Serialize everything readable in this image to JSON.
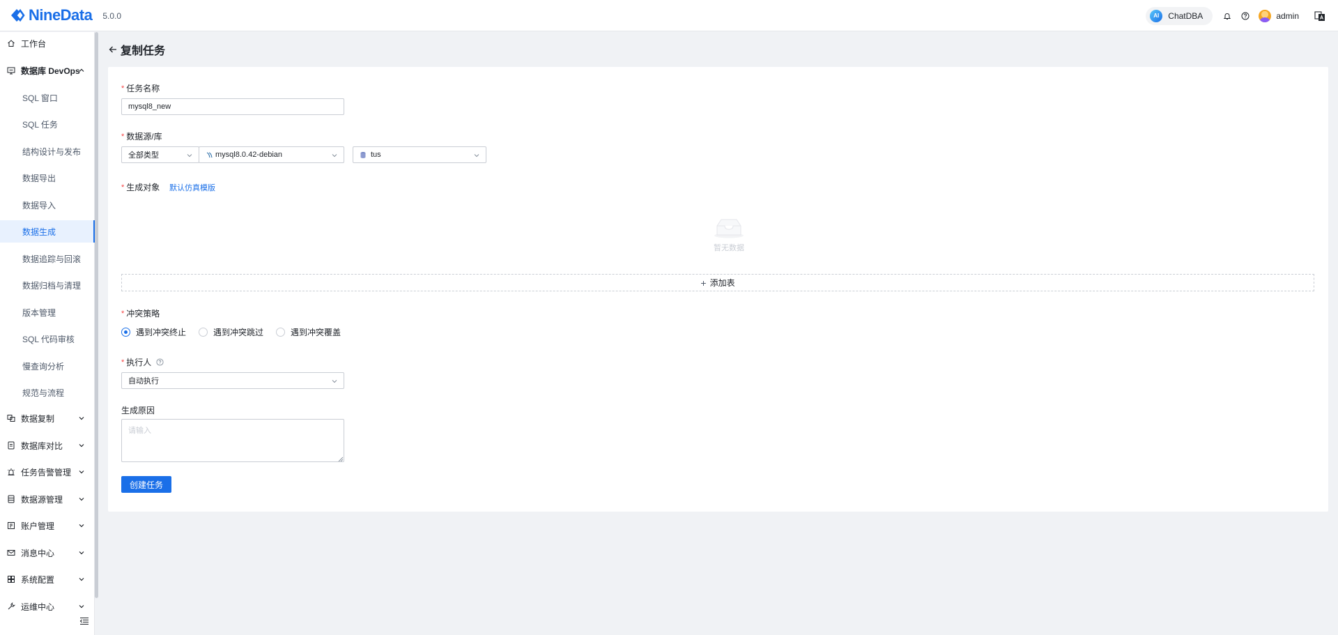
{
  "header": {
    "brand": "NineData",
    "version": "5.0.0",
    "chatdba_badge": "AI",
    "chatdba_label": "ChatDBA",
    "user_name": "admin"
  },
  "sidebar": {
    "items": [
      {
        "label": "工作台",
        "icon": "home-icon"
      },
      {
        "label": "数据库 DevOps",
        "icon": "devops-icon"
      },
      {
        "label": "数据复制",
        "icon": "replication-icon"
      },
      {
        "label": "数据库对比",
        "icon": "compare-icon"
      },
      {
        "label": "任务告警管理",
        "icon": "alarm-icon"
      },
      {
        "label": "数据源管理",
        "icon": "datasource-icon"
      },
      {
        "label": "账户管理",
        "icon": "account-icon"
      },
      {
        "label": "消息中心",
        "icon": "mail-icon"
      },
      {
        "label": "系统配置",
        "icon": "grid-icon"
      },
      {
        "label": "运维中心",
        "icon": "wrench-icon"
      }
    ],
    "devops_sub": [
      "SQL 窗口",
      "SQL 任务",
      "结构设计与发布",
      "数据导出",
      "数据导入",
      "数据生成",
      "数据追踪与回滚",
      "数据归档与清理",
      "版本管理",
      "SQL 代码审核",
      "慢查询分析",
      "规范与流程"
    ]
  },
  "page": {
    "title": "复制任务"
  },
  "form": {
    "required_mark": "*",
    "task_name_label": "任务名称",
    "task_name_value": "mysql8_new",
    "datasource_label": "数据源/库",
    "type_select": "全部类型",
    "datasource_select": "mysql8.0.42-debian",
    "database_select": "tus",
    "objects_label": "生成对象",
    "default_template_link": "默认仿真模版",
    "empty_text": "暂无数据",
    "add_table_plus": "+",
    "add_table_label": "添加表",
    "conflict_label": "冲突策略",
    "conflict_options": [
      "遇到冲突终止",
      "遇到冲突跳过",
      "遇到冲突覆盖"
    ],
    "executor_label": "执行人",
    "executor_select": "自动执行",
    "reason_label": "生成原因",
    "reason_placeholder": "请输入",
    "submit_label": "创建任务"
  },
  "colors": {
    "primary": "#1a6fe8",
    "required": "#f53f3f",
    "active_bg": "#e8f1fe"
  }
}
